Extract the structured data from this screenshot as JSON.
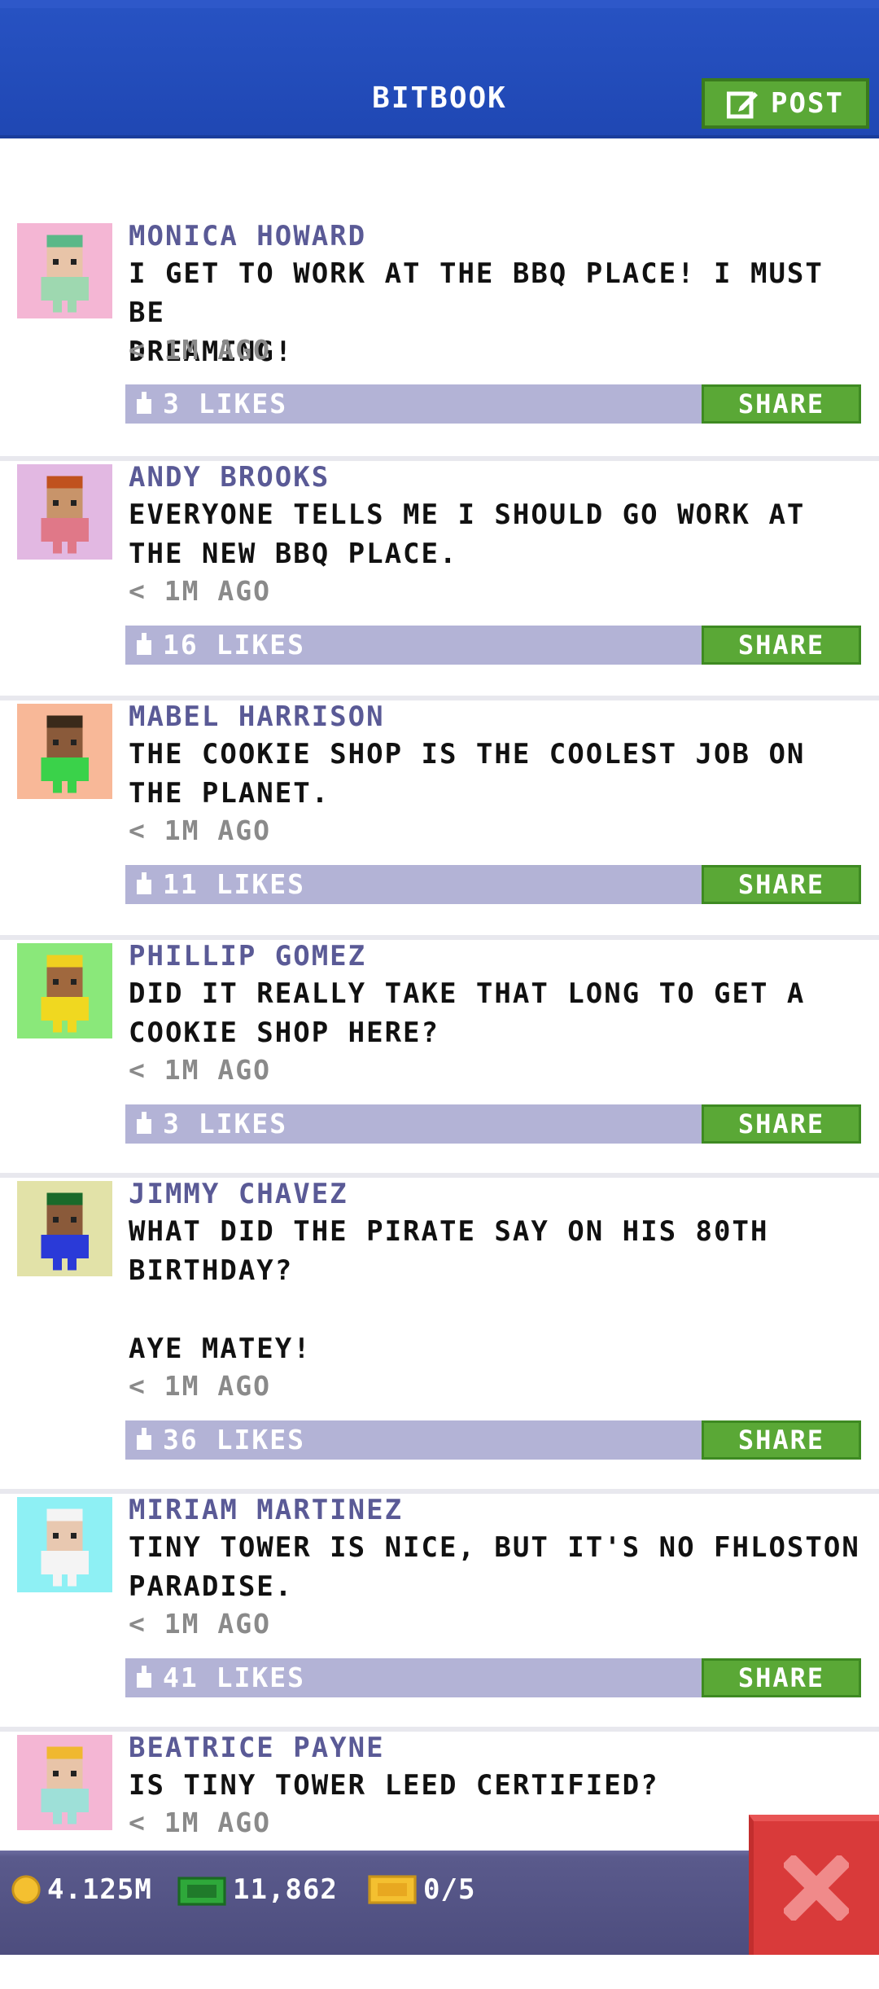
{
  "header": {
    "title": "BITBOOK",
    "post_label": "POST"
  },
  "posts": [
    {
      "name": "MONICA HOWARD",
      "message": "I GET TO WORK AT THE BBQ PLACE! I MUST BE\nDREAMING!",
      "time": "< 1M AGO",
      "likes": "3 LIKES",
      "share": "SHARE",
      "avatar_bg": "#f4b6d4",
      "skin": "#e8c4a8",
      "hair": "#5ab888",
      "shirt": "#9ed8b0"
    },
    {
      "name": "ANDY BROOKS",
      "message": "EVERYONE TELLS ME I SHOULD GO WORK AT\nTHE NEW BBQ PLACE.",
      "time": "< 1M AGO",
      "likes": "16 LIKES",
      "share": "SHARE",
      "avatar_bg": "#e2b8e2",
      "skin": "#c8946a",
      "hair": "#c0521e",
      "shirt": "#e07888"
    },
    {
      "name": "MABEL HARRISON",
      "message": "THE COOKIE SHOP IS THE COOLEST JOB ON\nTHE PLANET.",
      "time": "< 1M AGO",
      "likes": "11 LIKES",
      "share": "SHARE",
      "avatar_bg": "#f8b898",
      "skin": "#8a5a3a",
      "hair": "#3a2a1a",
      "shirt": "#3ad24a"
    },
    {
      "name": "PHILLIP GOMEZ",
      "message": "DID IT REALLY TAKE THAT LONG TO GET A\nCOOKIE SHOP HERE?",
      "time": "< 1M AGO",
      "likes": "3 LIKES",
      "share": "SHARE",
      "avatar_bg": "#8ae87a",
      "skin": "#a0683e",
      "hair": "#f0d020",
      "shirt": "#f0d820"
    },
    {
      "name": "JIMMY CHAVEZ",
      "message": "WHAT DID THE PIRATE SAY ON HIS 80TH\nBIRTHDAY?\n\nAYE MATEY!",
      "time": "< 1M AGO",
      "likes": "36 LIKES",
      "share": "SHARE",
      "avatar_bg": "#e2e2a8",
      "skin": "#8a5a3a",
      "hair": "#1a6a2a",
      "shirt": "#2a3ad8"
    },
    {
      "name": "MIRIAM MARTINEZ",
      "message": "TINY TOWER IS NICE, BUT IT'S NO FHLOSTON\nPARADISE.",
      "time": "< 1M AGO",
      "likes": "41 LIKES",
      "share": "SHARE",
      "avatar_bg": "#8ef0f4",
      "skin": "#e8c8b0",
      "hair": "#f4f4f4",
      "shirt": "#f4f4f4"
    },
    {
      "name": "BEATRICE PAYNE",
      "message": "IS TINY TOWER LEED CERTIFIED?",
      "time": "< 1M AGO",
      "likes": "",
      "share": "",
      "avatar_bg": "#f4b6d4",
      "skin": "#e8c4a8",
      "hair": "#f0b830",
      "shirt": "#9ee0d8"
    }
  ],
  "bottom_bar": {
    "coins": "4.125M",
    "bux": "11,862",
    "tickets": "0/5"
  },
  "colors": {
    "header_blue": "#2752c2",
    "share_green": "#5aa836",
    "likes_bar": "#b3b3d6",
    "name_purple": "#5a5a96",
    "close_red": "#d93a3a"
  },
  "icons": {
    "post": "edit-icon",
    "like": "thumb-icon",
    "coin": "coin-icon",
    "bux": "bux-icon",
    "ticket": "ticket-icon",
    "close": "close-icon"
  }
}
